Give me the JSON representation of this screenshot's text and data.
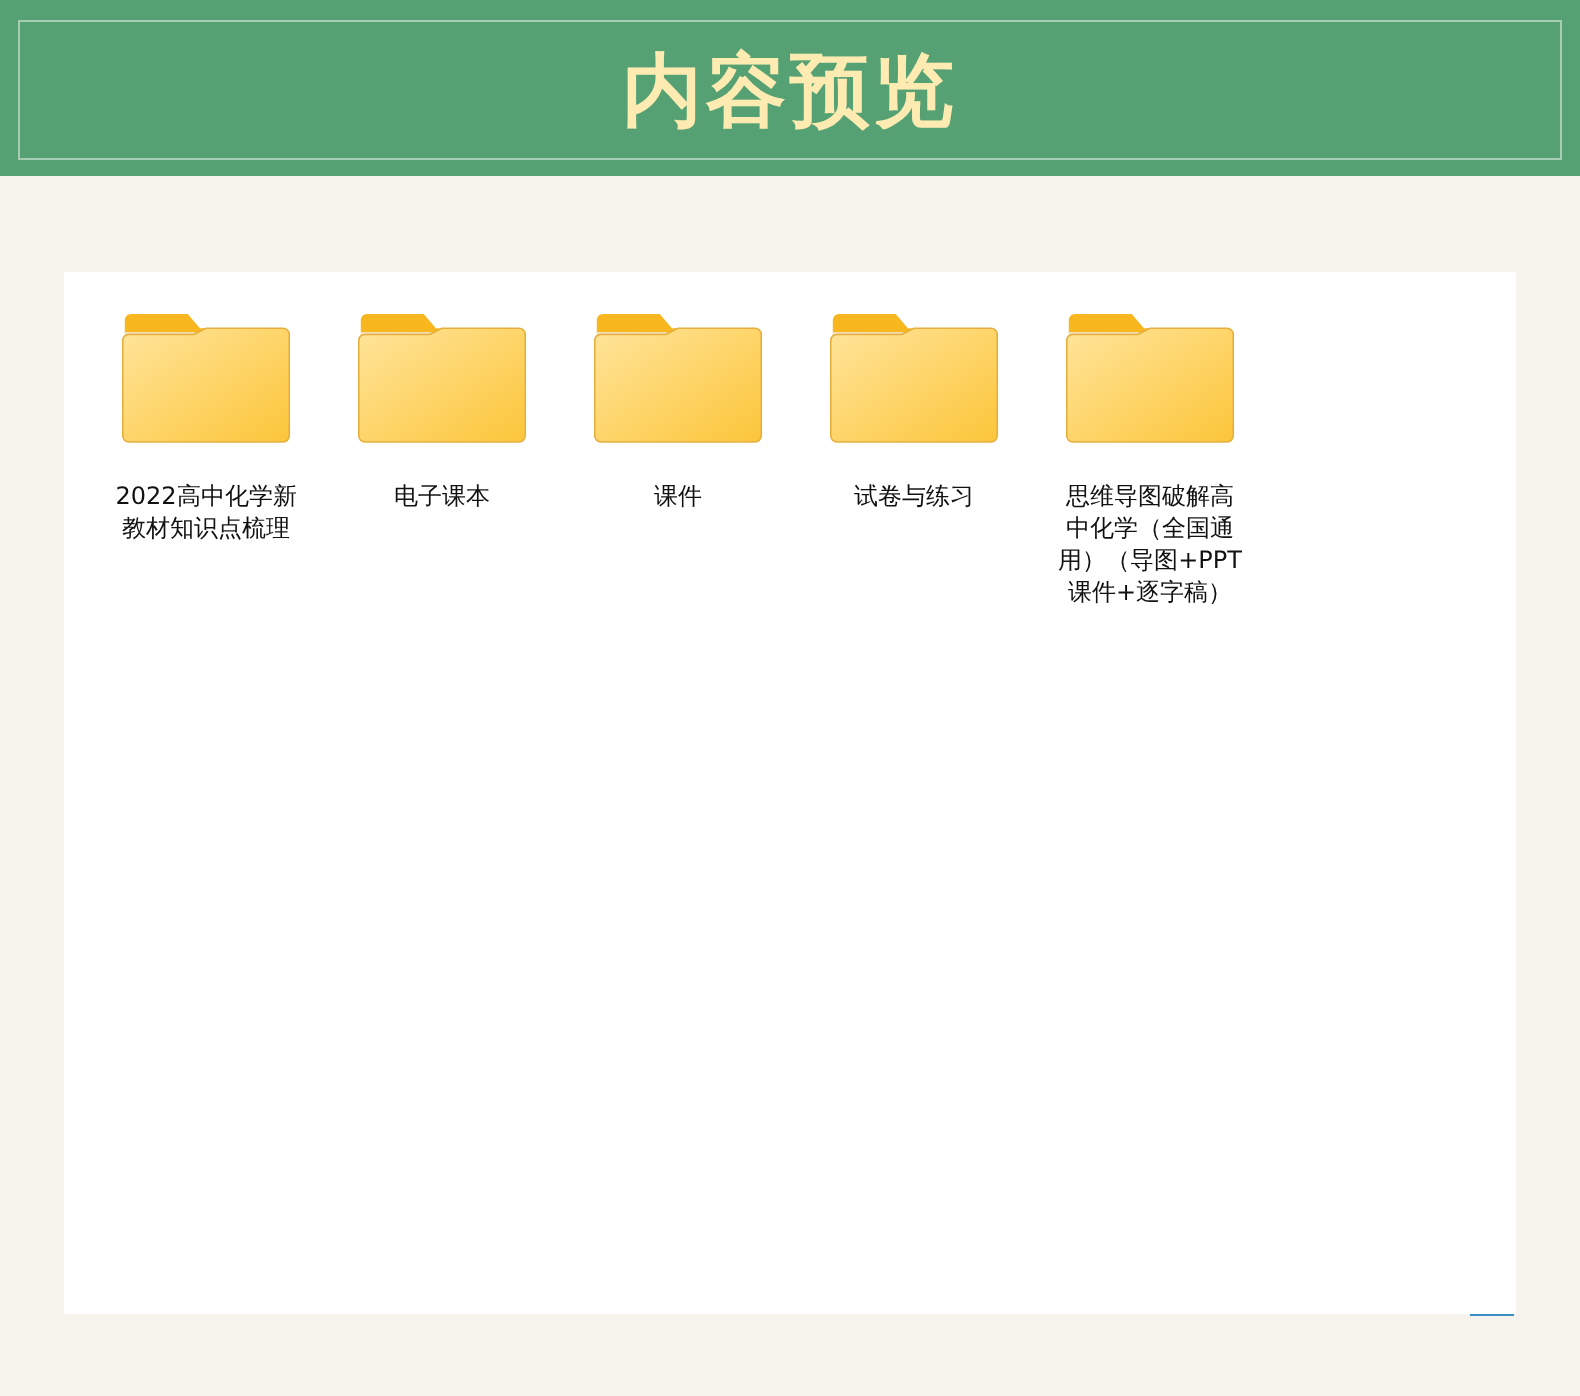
{
  "header": {
    "title": "内容预览"
  },
  "folders": [
    {
      "name": "2022高中化学新教材知识点梳理"
    },
    {
      "name": "电子课本"
    },
    {
      "name": "课件"
    },
    {
      "name": "试卷与练习"
    },
    {
      "name": "思维导图破解高中化学（全国通用）（导图+PPT课件+逐字稿）"
    }
  ]
}
